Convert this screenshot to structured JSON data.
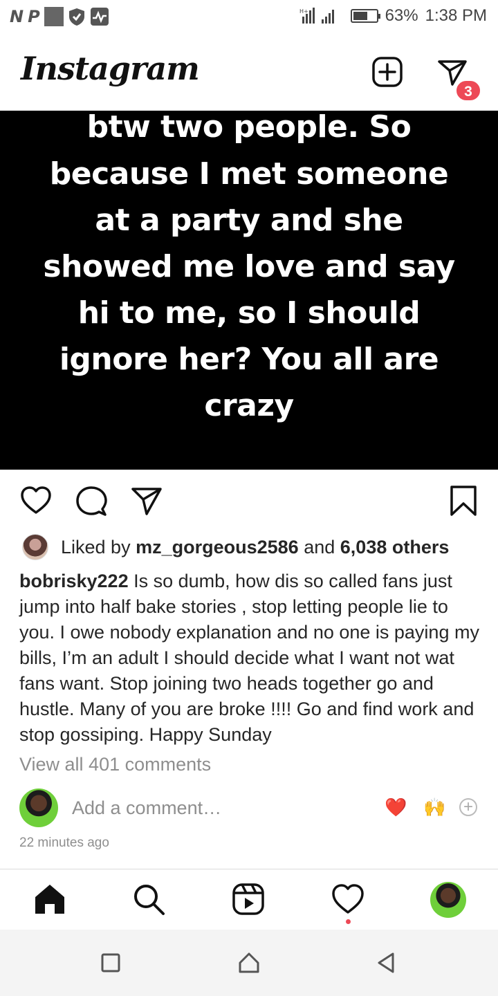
{
  "status_bar": {
    "left_glyphs": [
      "N",
      "P"
    ],
    "battery_percent": "63%",
    "battery_level": 0.63,
    "time": "1:38 PM"
  },
  "header": {
    "logo": "Instagram",
    "new_post_icon": "plus-square-icon",
    "dm_icon": "paper-plane-icon",
    "dm_badge": "3"
  },
  "post": {
    "image_text_lines": [
      "btw two people. So",
      "because I met someone",
      "at a party and she",
      "showed me love and say",
      "hi to me, so I should",
      "ignore her? You all are",
      "crazy"
    ],
    "likes": {
      "prefix": "Liked by",
      "user": "mz_gorgeous2586",
      "and": "and",
      "others": "6,038 others"
    },
    "caption": {
      "user": "bobrisky222",
      "text": "Is so dumb, how dis so called fans just jump into half bake stories , stop letting people lie to you. I owe nobody explanation and no one is paying my bills, I’m an adult I should decide what I want not wat fans want.  Stop joining two heads together go and hustle. Many of you are broke !!!! Go and find work and stop gossiping. Happy Sunday"
    },
    "view_comments": "View all 401 comments",
    "add_comment_placeholder": "Add a comment…",
    "quick_emojis": [
      "❤️",
      "🙌",
      "+"
    ],
    "timestamp": "22 minutes ago"
  },
  "colors": {
    "badge": "#ed4956",
    "muted_text": "#8e8e8e",
    "heart_emoji": "#e0132c"
  },
  "bottom_nav": {
    "items": [
      "home-icon",
      "search-icon",
      "reels-icon",
      "activity-heart-icon",
      "profile-avatar"
    ]
  },
  "system_nav": {
    "items": [
      "recents-square-icon",
      "home-circle-icon",
      "back-triangle-icon"
    ]
  }
}
